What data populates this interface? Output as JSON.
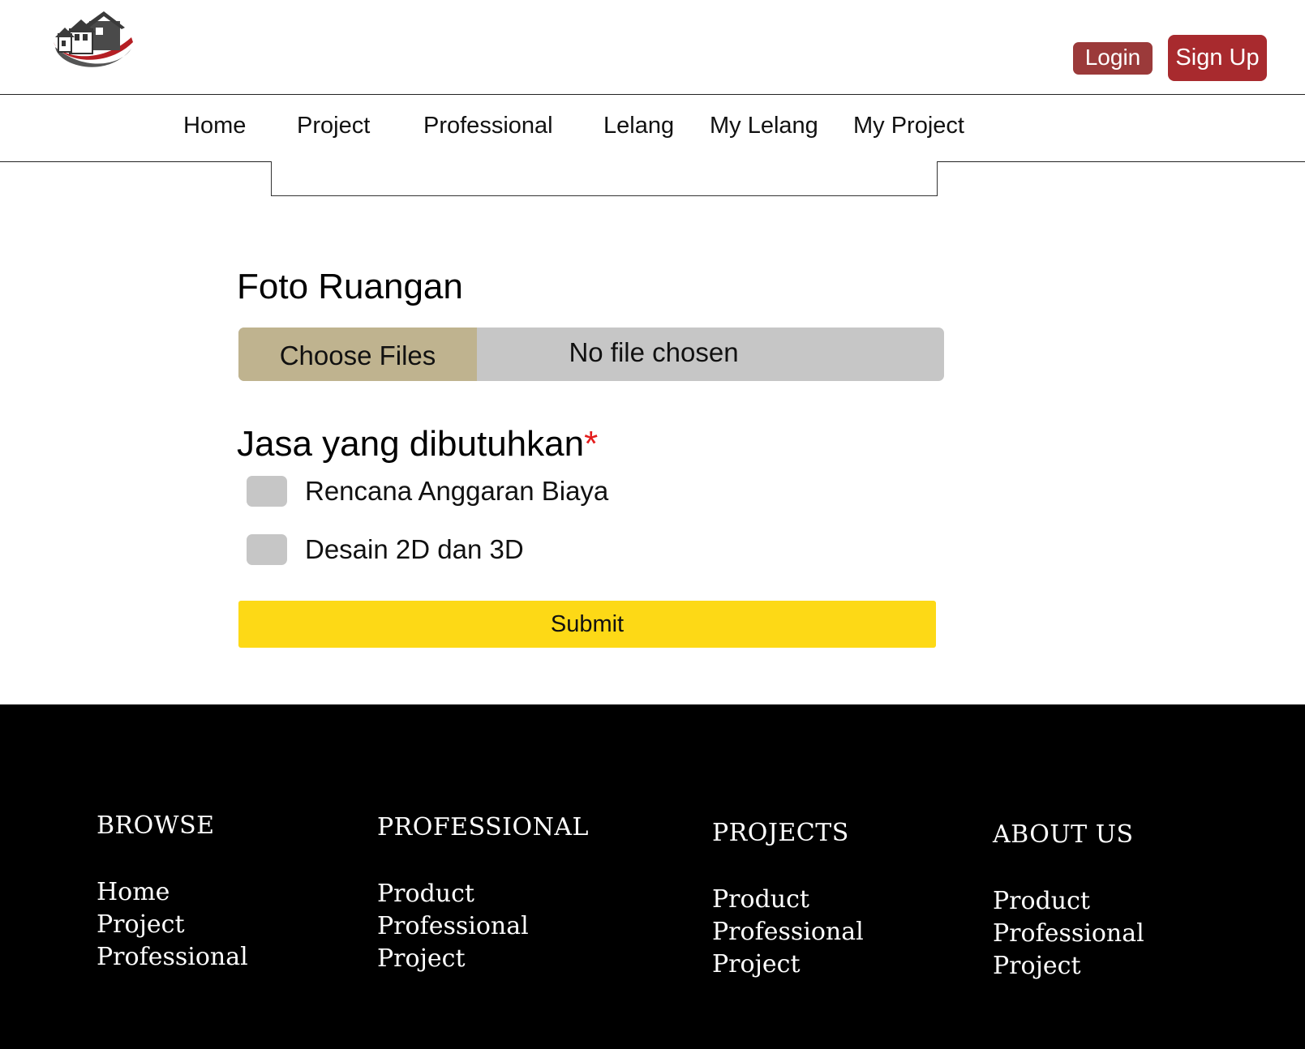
{
  "header": {
    "logo_icon": "house-logo-icon",
    "login_label": "Login",
    "signup_label": "Sign Up",
    "accent_color": "#a82a2e"
  },
  "nav": {
    "items": [
      "Home",
      "Project",
      "Professional",
      "Lelang",
      "My Lelang",
      "My Project"
    ]
  },
  "form": {
    "photo_label": "Foto Ruangan",
    "file_button_label": "Choose Files",
    "file_status": "No file chosen",
    "services_label": "Jasa yang dibutuhkan",
    "required_marker": "*",
    "options": [
      "Rencana Anggaran Biaya",
      "Desain 2D dan 3D"
    ],
    "submit_label": "Submit",
    "submit_color": "#fdd916"
  },
  "footer": {
    "columns": [
      {
        "heading": "BROWSE",
        "links": [
          "Home",
          "Project",
          "Professional"
        ]
      },
      {
        "heading": "PROFESSIONAL",
        "links": [
          "Product",
          "Professional",
          "Project"
        ]
      },
      {
        "heading": "PROJECTS",
        "links": [
          "Product",
          "Professional",
          "Project"
        ]
      },
      {
        "heading": "ABOUT US",
        "links": [
          "Product",
          "Professional",
          "Project"
        ]
      }
    ]
  }
}
